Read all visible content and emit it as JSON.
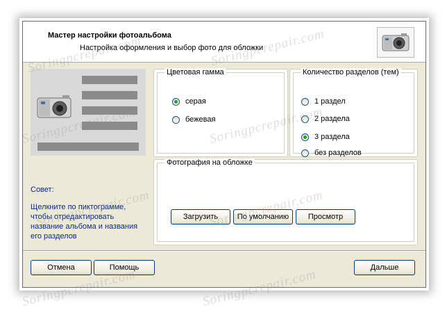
{
  "header": {
    "title": "Мастер настройки фотоальбома",
    "subtitle": "Настройка оформления и выбор фото для обложки"
  },
  "tip": {
    "title": "Совет:",
    "text": "Щелкните по пиктограмме, чтобы отредактировать название альбома и названия его разделов"
  },
  "color_scheme": {
    "legend": "Цветовая гамма",
    "options": [
      {
        "label": "серая",
        "checked": true
      },
      {
        "label": "бежевая",
        "checked": false
      }
    ]
  },
  "sections": {
    "legend": "Количество разделов (тем)",
    "options": [
      {
        "label": "1 раздел",
        "checked": false
      },
      {
        "label": "2 раздела",
        "checked": false
      },
      {
        "label": "3 раздела",
        "checked": true
      },
      {
        "label": "без разделов",
        "checked": false
      }
    ]
  },
  "cover": {
    "legend": "Фотография на обложке",
    "load_label": "Загрузить",
    "default_label": "По умолчанию",
    "view_label": "Просмотр"
  },
  "footer": {
    "cancel_label": "Отмена",
    "help_label": "Помощь",
    "next_label": "Дальше"
  },
  "watermark": "Soringpcrepair.com",
  "colors": {
    "window_bg": "#ece9d8",
    "tip_text": "#0a2a86",
    "radio_dot": "#21a121",
    "button_border": "#003c74"
  }
}
